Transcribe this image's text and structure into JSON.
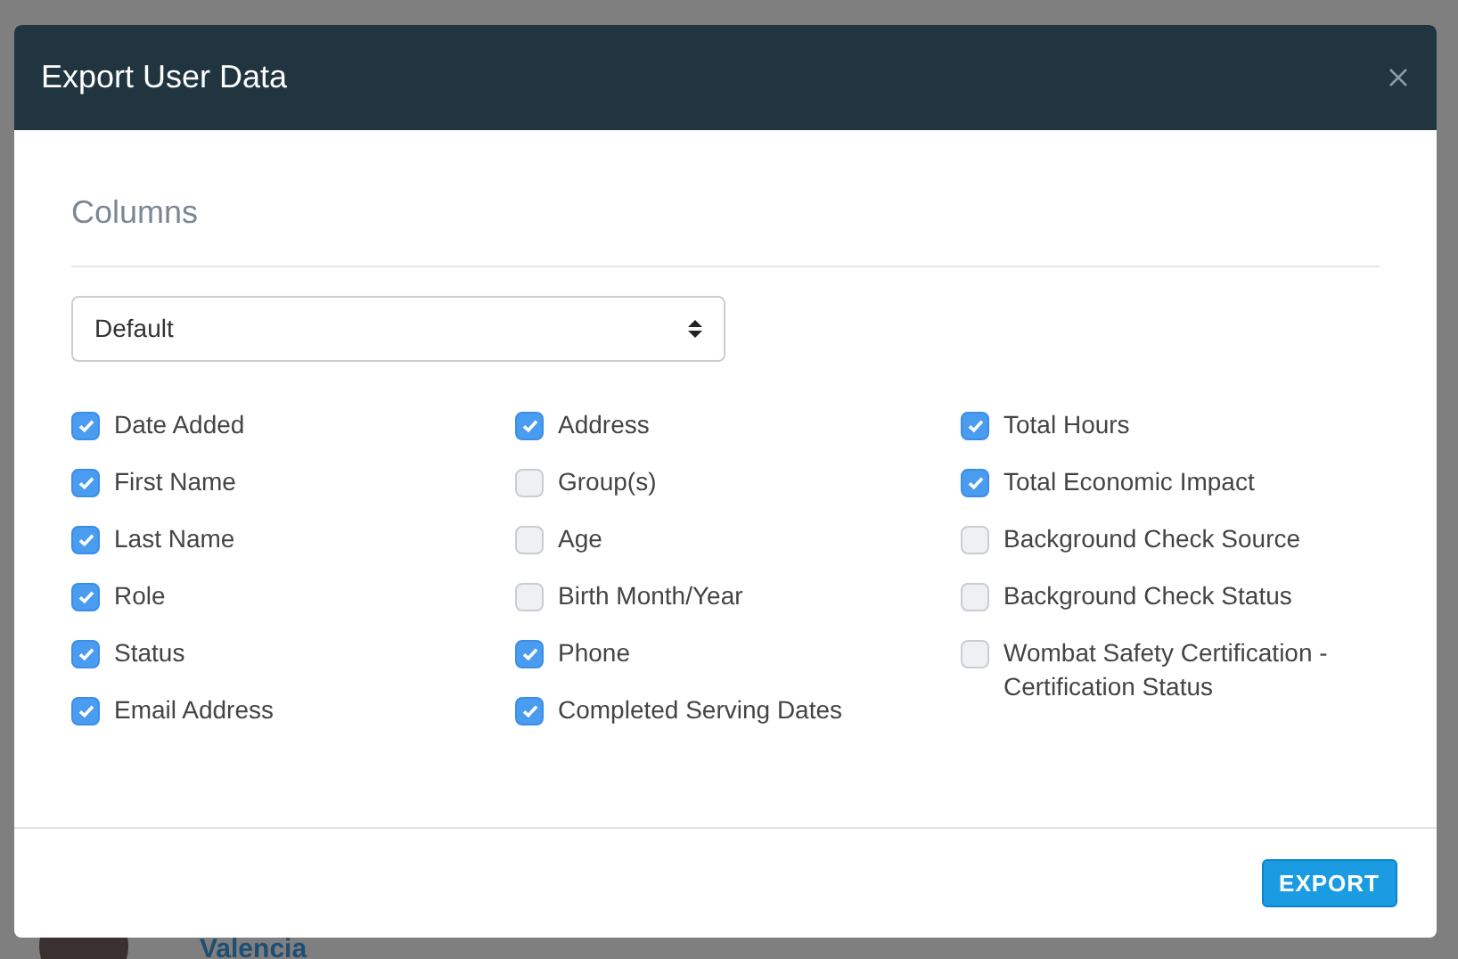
{
  "background": {
    "link": "Valencia"
  },
  "dialog": {
    "title": "Export User Data",
    "section_title": "Columns",
    "select": {
      "value": "Default"
    },
    "columns": [
      [
        {
          "label": "Date Added",
          "checked": true
        },
        {
          "label": "First Name",
          "checked": true
        },
        {
          "label": "Last Name",
          "checked": true
        },
        {
          "label": "Role",
          "checked": true
        },
        {
          "label": "Status",
          "checked": true
        },
        {
          "label": "Email Address",
          "checked": true
        }
      ],
      [
        {
          "label": "Address",
          "checked": true
        },
        {
          "label": "Group(s)",
          "checked": false
        },
        {
          "label": "Age",
          "checked": false
        },
        {
          "label": "Birth Month/Year",
          "checked": false
        },
        {
          "label": "Phone",
          "checked": true
        },
        {
          "label": "Completed Serving Dates",
          "checked": true
        }
      ],
      [
        {
          "label": "Total Hours",
          "checked": true
        },
        {
          "label": "Total Economic Impact",
          "checked": true
        },
        {
          "label": "Background Check Source",
          "checked": false
        },
        {
          "label": "Background Check Status",
          "checked": false
        },
        {
          "label": "Wombat Safety Certification - Certification Status",
          "checked": false
        }
      ]
    ],
    "export_button": "EXPORT"
  }
}
